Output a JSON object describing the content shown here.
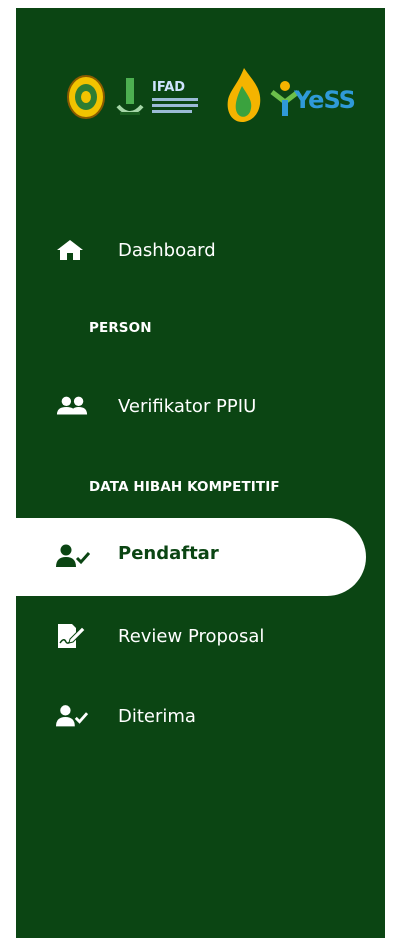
{
  "colors": {
    "sidebar_bg": "#0b4513",
    "active_bg": "#ffffff",
    "active_text": "#0b4513",
    "text": "#ffffff"
  },
  "logos": [
    {
      "icon": "university-seal-logo"
    },
    {
      "icon": "ministry-logo"
    },
    {
      "icon": "ifad-logo",
      "text": "IFAD"
    },
    {
      "icon": "flame-logo"
    },
    {
      "icon": "yess-logo",
      "text": "YeSS"
    }
  ],
  "menu": {
    "dashboard": {
      "label": "Dashboard",
      "icon": "home-icon"
    },
    "section_person": "PERSON",
    "verifikator": {
      "label": "Verifikator PPIU",
      "icon": "users-icon"
    },
    "section_hibah": "DATA HIBAH KOMPETITIF",
    "pendaftar": {
      "label": "Pendaftar",
      "icon": "user-check-icon",
      "active": true
    },
    "review": {
      "label": "Review Proposal",
      "icon": "file-signature-icon"
    },
    "diterima": {
      "label": "Diterima",
      "icon": "user-check-icon"
    }
  }
}
